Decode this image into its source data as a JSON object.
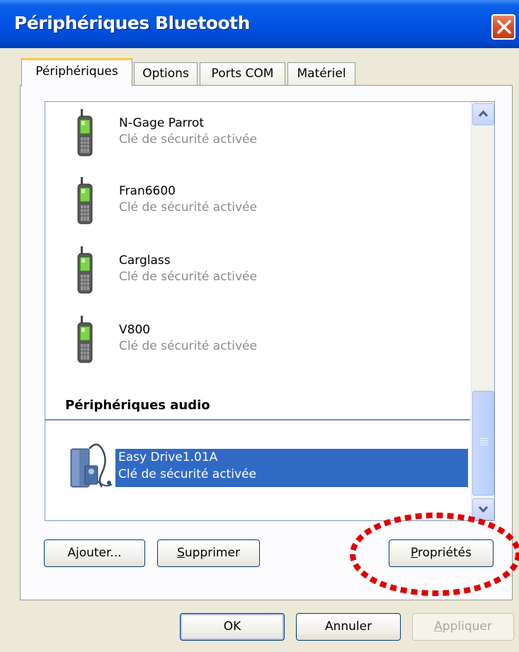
{
  "window": {
    "title": "Périphériques Bluetooth"
  },
  "tabs": [
    {
      "label": "Périphériques",
      "active": true
    },
    {
      "label": "Options",
      "active": false
    },
    {
      "label": "Ports COM",
      "active": false
    },
    {
      "label": "Matériel",
      "active": false
    }
  ],
  "devices": [
    {
      "name": "N-Gage Parrot",
      "status": "Clé de sécurité activée",
      "icon": "mobile-phone-icon"
    },
    {
      "name": "Fran6600",
      "status": "Clé de sécurité activée",
      "icon": "mobile-phone-icon"
    },
    {
      "name": "Carglass",
      "status": "Clé de sécurité activée",
      "icon": "mobile-phone-icon"
    },
    {
      "name": "V800",
      "status": "Clé de sécurité activée",
      "icon": "mobile-phone-icon"
    }
  ],
  "audio_group": {
    "label": "Périphériques audio",
    "devices": [
      {
        "name": "Easy Drive1.01A",
        "status": "Clé de sécurité activée",
        "icon": "handsfree-audio-icon",
        "selected": true
      }
    ]
  },
  "buttons": {
    "add": "Ajouter...",
    "remove": "Supprimer",
    "properties": "Propriétés",
    "ok": "OK",
    "cancel": "Annuler",
    "apply": "Appliquer"
  },
  "colors": {
    "titlebar": "#0054e3",
    "selection": "#316ac5",
    "annotation_circle": "#e00000",
    "active_tab_accent": "#ffc83c"
  }
}
